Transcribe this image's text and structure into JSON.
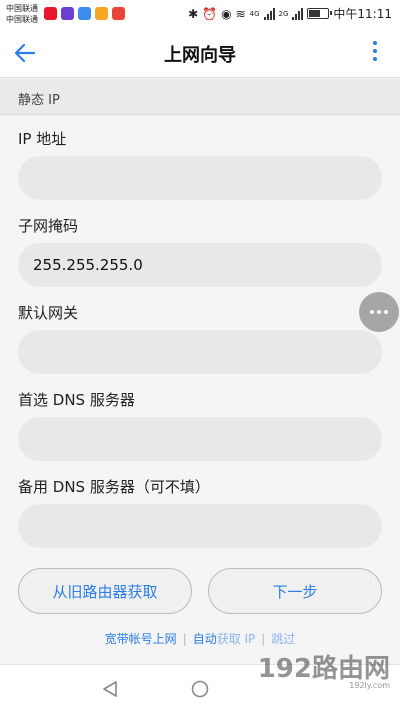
{
  "status_bar": {
    "carrier1": "中国联通",
    "carrier2": "中国联通",
    "net1": "4G",
    "net2": "2G",
    "time": "中午11:11"
  },
  "header": {
    "title": "上网向导"
  },
  "section": {
    "title": "静态 IP"
  },
  "form": {
    "ip_label": "IP 地址",
    "ip_value": "",
    "subnet_label": "子网掩码",
    "subnet_value": "255.255.255.0",
    "gateway_label": "默认网关",
    "gateway_value": "",
    "dns1_label": "首选 DNS 服务器",
    "dns1_value": "",
    "dns2_label": "备用 DNS 服务器（可不填）",
    "dns2_value": ""
  },
  "buttons": {
    "restore": "从旧路由器获取",
    "next": "下一步"
  },
  "links": {
    "broadband": "宽带帐号上网",
    "auto_prefix": "自动",
    "auto_suffix": "获取 IP",
    "skip": "跳过"
  },
  "watermark": {
    "text": "192路由网",
    "url": "192ly.com"
  },
  "colors": {
    "accent": "#2b7de9"
  }
}
